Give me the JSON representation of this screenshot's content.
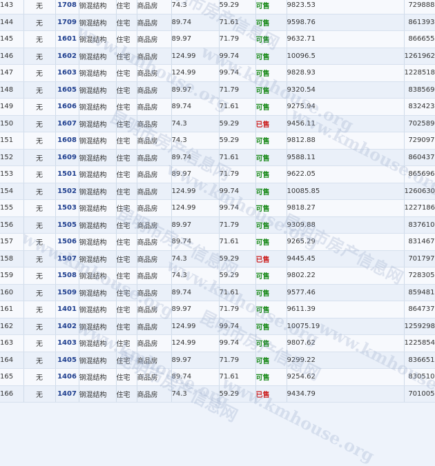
{
  "status_colors": {
    "available": "#1a8a1a",
    "sold": "#cc2222"
  },
  "watermark": {
    "name": "昆明市房产信息网",
    "url": "www.kmhouse.org"
  },
  "rows": [
    {
      "idx": "143",
      "mark": "无",
      "room": "1708",
      "structure": "钢混结构",
      "use": "住宅",
      "type": "商品房",
      "area": "74.3",
      "inner": "59.29",
      "status": "可售",
      "price": "9823.53",
      "total": "729888"
    },
    {
      "idx": "144",
      "mark": "无",
      "room": "1709",
      "structure": "钢混结构",
      "use": "住宅",
      "type": "商品房",
      "area": "89.74",
      "inner": "71.61",
      "status": "可售",
      "price": "9598.76",
      "total": "861393"
    },
    {
      "idx": "145",
      "mark": "无",
      "room": "1601",
      "structure": "钢混结构",
      "use": "住宅",
      "type": "商品房",
      "area": "89.97",
      "inner": "71.79",
      "status": "可售",
      "price": "9632.71",
      "total": "866655"
    },
    {
      "idx": "146",
      "mark": "无",
      "room": "1602",
      "structure": "钢混结构",
      "use": "住宅",
      "type": "商品房",
      "area": "124.99",
      "inner": "99.74",
      "status": "可售",
      "price": "10096.5",
      "total": "1261962"
    },
    {
      "idx": "147",
      "mark": "无",
      "room": "1603",
      "structure": "钢混结构",
      "use": "住宅",
      "type": "商品房",
      "area": "124.99",
      "inner": "99.74",
      "status": "可售",
      "price": "9828.93",
      "total": "1228518"
    },
    {
      "idx": "148",
      "mark": "无",
      "room": "1605",
      "structure": "钢混结构",
      "use": "住宅",
      "type": "商品房",
      "area": "89.97",
      "inner": "71.79",
      "status": "可售",
      "price": "9320.54",
      "total": "838569"
    },
    {
      "idx": "149",
      "mark": "无",
      "room": "1606",
      "structure": "钢混结构",
      "use": "住宅",
      "type": "商品房",
      "area": "89.74",
      "inner": "71.61",
      "status": "可售",
      "price": "9275.94",
      "total": "832423"
    },
    {
      "idx": "150",
      "mark": "无",
      "room": "1607",
      "structure": "钢混结构",
      "use": "住宅",
      "type": "商品房",
      "area": "74.3",
      "inner": "59.29",
      "status": "已售",
      "price": "9456.11",
      "total": "702589"
    },
    {
      "idx": "151",
      "mark": "无",
      "room": "1608",
      "structure": "钢混结构",
      "use": "住宅",
      "type": "商品房",
      "area": "74.3",
      "inner": "59.29",
      "status": "可售",
      "price": "9812.88",
      "total": "729097"
    },
    {
      "idx": "152",
      "mark": "无",
      "room": "1609",
      "structure": "钢混结构",
      "use": "住宅",
      "type": "商品房",
      "area": "89.74",
      "inner": "71.61",
      "status": "可售",
      "price": "9588.11",
      "total": "860437"
    },
    {
      "idx": "153",
      "mark": "无",
      "room": "1501",
      "structure": "钢混结构",
      "use": "住宅",
      "type": "商品房",
      "area": "89.97",
      "inner": "71.79",
      "status": "可售",
      "price": "9622.05",
      "total": "865696"
    },
    {
      "idx": "154",
      "mark": "无",
      "room": "1502",
      "structure": "钢混结构",
      "use": "住宅",
      "type": "商品房",
      "area": "124.99",
      "inner": "99.74",
      "status": "可售",
      "price": "10085.85",
      "total": "1260630"
    },
    {
      "idx": "155",
      "mark": "无",
      "room": "1503",
      "structure": "钢混结构",
      "use": "住宅",
      "type": "商品房",
      "area": "124.99",
      "inner": "99.74",
      "status": "可售",
      "price": "9818.27",
      "total": "1227186"
    },
    {
      "idx": "156",
      "mark": "无",
      "room": "1505",
      "structure": "钢混结构",
      "use": "住宅",
      "type": "商品房",
      "area": "89.97",
      "inner": "71.79",
      "status": "可售",
      "price": "9309.88",
      "total": "837610"
    },
    {
      "idx": "157",
      "mark": "无",
      "room": "1506",
      "structure": "钢混结构",
      "use": "住宅",
      "type": "商品房",
      "area": "89.74",
      "inner": "71.61",
      "status": "可售",
      "price": "9265.29",
      "total": "831467"
    },
    {
      "idx": "158",
      "mark": "无",
      "room": "1507",
      "structure": "钢混结构",
      "use": "住宅",
      "type": "商品房",
      "area": "74.3",
      "inner": "59.29",
      "status": "已售",
      "price": "9445.45",
      "total": "701797"
    },
    {
      "idx": "159",
      "mark": "无",
      "room": "1508",
      "structure": "钢混结构",
      "use": "住宅",
      "type": "商品房",
      "area": "74.3",
      "inner": "59.29",
      "status": "可售",
      "price": "9802.22",
      "total": "728305"
    },
    {
      "idx": "160",
      "mark": "无",
      "room": "1509",
      "structure": "钢混结构",
      "use": "住宅",
      "type": "商品房",
      "area": "89.74",
      "inner": "71.61",
      "status": "可售",
      "price": "9577.46",
      "total": "859481"
    },
    {
      "idx": "161",
      "mark": "无",
      "room": "1401",
      "structure": "钢混结构",
      "use": "住宅",
      "type": "商品房",
      "area": "89.97",
      "inner": "71.79",
      "status": "可售",
      "price": "9611.39",
      "total": "864737"
    },
    {
      "idx": "162",
      "mark": "无",
      "room": "1402",
      "structure": "钢混结构",
      "use": "住宅",
      "type": "商品房",
      "area": "124.99",
      "inner": "99.74",
      "status": "可售",
      "price": "10075.19",
      "total": "1259298"
    },
    {
      "idx": "163",
      "mark": "无",
      "room": "1403",
      "structure": "钢混结构",
      "use": "住宅",
      "type": "商品房",
      "area": "124.99",
      "inner": "99.74",
      "status": "可售",
      "price": "9807.62",
      "total": "1225854"
    },
    {
      "idx": "164",
      "mark": "无",
      "room": "1405",
      "structure": "钢混结构",
      "use": "住宅",
      "type": "商品房",
      "area": "89.97",
      "inner": "71.79",
      "status": "可售",
      "price": "9299.22",
      "total": "836651"
    },
    {
      "idx": "165",
      "mark": "无",
      "room": "1406",
      "structure": "钢混结构",
      "use": "住宅",
      "type": "商品房",
      "area": "89.74",
      "inner": "71.61",
      "status": "可售",
      "price": "9254.62",
      "total": "830510"
    },
    {
      "idx": "166",
      "mark": "无",
      "room": "1407",
      "structure": "钢混结构",
      "use": "住宅",
      "type": "商品房",
      "area": "74.3",
      "inner": "59.29",
      "status": "已售",
      "price": "9434.79",
      "total": "701005"
    }
  ]
}
